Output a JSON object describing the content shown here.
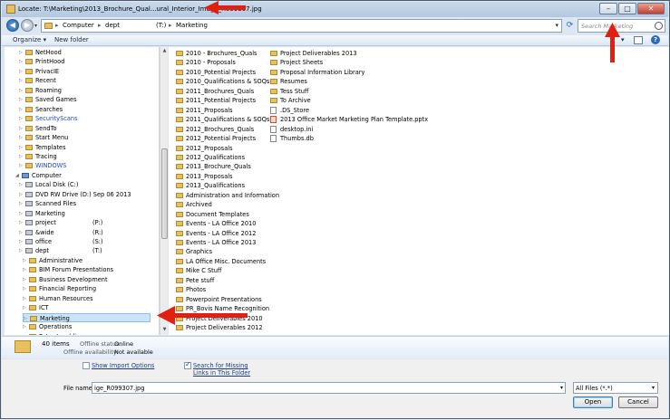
{
  "window": {
    "title": "Locate: T:\\Marketing\\2013_Brochure_Qual...ural_Interior_Image_R099307.jpg",
    "min": "–",
    "max": "□",
    "close": "✕"
  },
  "address": {
    "back": "◀",
    "forward": "▶",
    "crumbs": [
      "Computer",
      "dept",
      "(T:)",
      "Marketing"
    ],
    "sep": "▸",
    "search_placeholder": "Search Marketing"
  },
  "toolbar": {
    "organize": "Organize ▾",
    "new_folder": "New folder"
  },
  "tree": [
    {
      "label": "NetHood",
      "indent": 1,
      "type": "folder"
    },
    {
      "label": "PrintHood",
      "indent": 1,
      "type": "folder"
    },
    {
      "label": "PrivacIE",
      "indent": 1,
      "type": "folder"
    },
    {
      "label": "Recent",
      "indent": 1,
      "type": "folder"
    },
    {
      "label": "Roaming",
      "indent": 1,
      "type": "folder"
    },
    {
      "label": "Saved Games",
      "indent": 1,
      "type": "folder"
    },
    {
      "label": "Searches",
      "indent": 1,
      "type": "folder"
    },
    {
      "label": "SecurityScans",
      "indent": 1,
      "type": "folder",
      "color": "#1a4ac0"
    },
    {
      "label": "SendTo",
      "indent": 1,
      "type": "folder"
    },
    {
      "label": "Start Menu",
      "indent": 1,
      "type": "folder"
    },
    {
      "label": "Templates",
      "indent": 1,
      "type": "folder"
    },
    {
      "label": "Tracing",
      "indent": 1,
      "type": "folder"
    },
    {
      "label": "WINDOWS",
      "indent": 1,
      "type": "folder",
      "color": "#1a4ac0"
    },
    {
      "label": "Computer",
      "indent": 0,
      "type": "computer"
    },
    {
      "label": "Local Disk (C:)",
      "indent": 1,
      "type": "drive"
    },
    {
      "label": "DVD RW Drive (D:) Sep 06 2013",
      "indent": 1,
      "type": "drive"
    },
    {
      "label": "Scanned Files",
      "indent": 1,
      "type": "drive"
    },
    {
      "label": "Marketing",
      "indent": 1,
      "type": "drive"
    },
    {
      "label": "project",
      "letter": "(P:)",
      "indent": 1,
      "type": "drive"
    },
    {
      "label": "&wide",
      "letter": "(R:)",
      "indent": 1,
      "type": "drive"
    },
    {
      "label": "office",
      "letter": "(S:)",
      "indent": 1,
      "type": "drive"
    },
    {
      "label": "dept",
      "letter": "(T:)",
      "indent": 1,
      "type": "drive"
    },
    {
      "label": "Administrative",
      "indent": 2,
      "type": "folder"
    },
    {
      "label": "BIM Forum Presentations",
      "indent": 2,
      "type": "folder"
    },
    {
      "label": "Business Development",
      "indent": 2,
      "type": "folder"
    },
    {
      "label": "Financial Reporting",
      "indent": 2,
      "type": "folder"
    },
    {
      "label": "Human Resources",
      "indent": 2,
      "type": "folder"
    },
    {
      "label": "ICT",
      "indent": 2,
      "type": "folder"
    },
    {
      "label": "Marketing",
      "indent": 2,
      "type": "folder",
      "selected": true
    },
    {
      "label": "Operations",
      "indent": 2,
      "type": "folder"
    },
    {
      "label": "Peter Loedding",
      "indent": 2,
      "type": "folder"
    }
  ],
  "files_col1": [
    {
      "name": "2010 - Brochures_Quals",
      "type": "folder"
    },
    {
      "name": "2010 - Proposals",
      "type": "folder"
    },
    {
      "name": "2010_Potential Projects",
      "type": "folder"
    },
    {
      "name": "2010_Qualifications & SOQs",
      "type": "folder"
    },
    {
      "name": "2011_Brochures_Quals",
      "type": "folder"
    },
    {
      "name": "2011_Potential Projects",
      "type": "folder"
    },
    {
      "name": "2011_Proposals",
      "type": "folder"
    },
    {
      "name": "2011_Qualifications & SOQs",
      "type": "folder"
    },
    {
      "name": "2012_Brochures_Quals",
      "type": "folder"
    },
    {
      "name": "2012_Potential Projects",
      "type": "folder"
    },
    {
      "name": "2012_Proposals",
      "type": "folder"
    },
    {
      "name": "2012_Qualifications",
      "type": "folder"
    },
    {
      "name": "2013_Brochure_Quals",
      "type": "folder"
    },
    {
      "name": "2013_Proposals",
      "type": "folder"
    },
    {
      "name": "2013_Qualifications",
      "type": "folder"
    },
    {
      "name": "Administration and Information",
      "type": "folder"
    },
    {
      "name": "Archived",
      "type": "folder"
    },
    {
      "name": "Document Templates",
      "type": "folder"
    },
    {
      "name": "Events - LA Office 2010",
      "type": "folder"
    },
    {
      "name": "Events - LA Office 2012",
      "type": "folder"
    },
    {
      "name": "Events - LA Office 2013",
      "type": "folder"
    },
    {
      "name": "Graphics",
      "type": "folder"
    },
    {
      "name": "LA Office Misc. Documents",
      "type": "folder"
    },
    {
      "name": "Mike C Stuff",
      "type": "folder"
    },
    {
      "name": "Pete stuff",
      "type": "folder"
    },
    {
      "name": "Photos",
      "type": "folder"
    },
    {
      "name": "Powerpoint Presentations",
      "type": "folder"
    },
    {
      "name": "PR_Bovis Name Recognition",
      "type": "folder"
    },
    {
      "name": "Project Deliverables 2010",
      "type": "folder"
    },
    {
      "name": "Project Deliverables 2012",
      "type": "folder"
    }
  ],
  "files_col2": [
    {
      "name": "Project Deliverables 2013",
      "type": "folder"
    },
    {
      "name": "Project Sheets",
      "type": "folder"
    },
    {
      "name": "Proposal Information Library",
      "type": "folder"
    },
    {
      "name": "Resumes",
      "type": "folder"
    },
    {
      "name": "Tess Stuff",
      "type": "folder"
    },
    {
      "name": "To Archive",
      "type": "folder"
    },
    {
      "name": ".DS_Store",
      "type": "doc"
    },
    {
      "name": "2013 Office  Market Marketing Plan Template.pptx",
      "type": "ppt"
    },
    {
      "name": "desktop.ini",
      "type": "doc"
    },
    {
      "name": "Thumbs.db",
      "type": "doc"
    }
  ],
  "details": {
    "count": "40 items",
    "status_key": "Offline status:",
    "status_val": "Online",
    "avail_key": "Offline availability:",
    "avail_val": "Not available"
  },
  "bottom": {
    "show_import": "Show Import Options",
    "search_missing_1": "Search for Missing",
    "search_missing_2": "Links in This Folder",
    "file_name_label": "File name:",
    "file_name_value": "ige_R099307.jpg",
    "file_type": "All Files (*.*)",
    "open": "Open",
    "cancel": "Cancel"
  }
}
